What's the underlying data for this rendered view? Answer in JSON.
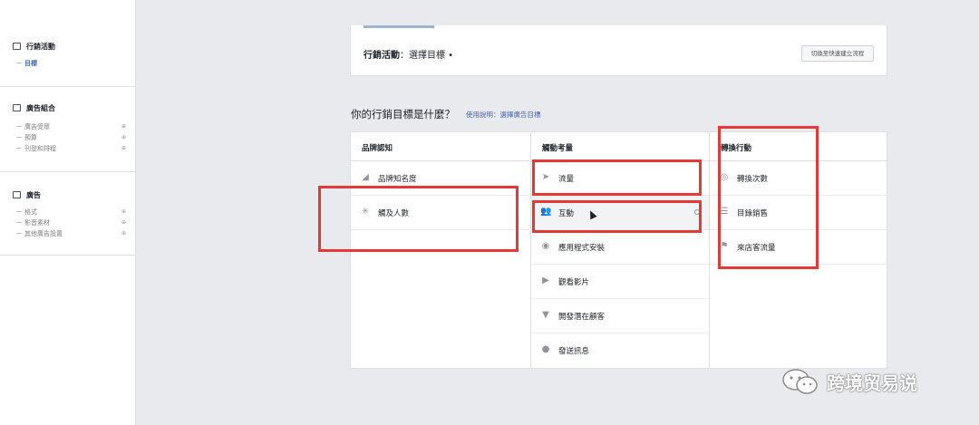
{
  "sidebar": {
    "campaign": {
      "title": "行銷活動",
      "sub": "目標"
    },
    "adset": {
      "title": "廣告組合",
      "items": [
        "廣告受眾",
        "預算",
        "刊登和排程"
      ]
    },
    "ad": {
      "title": "廣告",
      "items": [
        "格式",
        "影音素材",
        "其他廣告設置"
      ]
    },
    "lock_symbol": "⊕"
  },
  "top_panel": {
    "label_bold": "行銷活動",
    "label_rest": "：選擇目標 •",
    "button_label": "切換至快速建立流程"
  },
  "question": {
    "text": "你的行銷目標是什麼？",
    "link": "使用說明：選擇廣告目標"
  },
  "columns": [
    {
      "header": "品牌認知",
      "rows": [
        {
          "label": "品牌知名度",
          "icon": "megaphone-icon",
          "glyph": "◢"
        },
        {
          "label": "觸及人數",
          "icon": "asterisk-icon",
          "glyph": "✳"
        }
      ]
    },
    {
      "header": "觸動考量",
      "rows": [
        {
          "label": "流量",
          "icon": "cursor-icon",
          "glyph": "➤"
        },
        {
          "label": "互動",
          "icon": "people-icon",
          "glyph": "👥"
        },
        {
          "label": "應用程式安裝",
          "icon": "app-icon",
          "glyph": "◉"
        },
        {
          "label": "觀看影片",
          "icon": "video-icon",
          "glyph": "▶"
        },
        {
          "label": "開發潛在顧客",
          "icon": "funnel-icon",
          "glyph": "▼"
        },
        {
          "label": "發送訊息",
          "icon": "chat-icon",
          "glyph": "●"
        }
      ]
    },
    {
      "header": "轉換行動",
      "rows": [
        {
          "label": "轉換次數",
          "icon": "globe-icon",
          "glyph": "◎"
        },
        {
          "label": "目錄銷售",
          "icon": "catalog-icon",
          "glyph": "☰"
        },
        {
          "label": "來店客流量",
          "icon": "store-icon",
          "glyph": "⚑"
        }
      ]
    }
  ],
  "watermark": {
    "text": "跨境贸易说"
  },
  "colors": {
    "annotation_red": "#e53935",
    "link_blue": "#4267b2"
  }
}
